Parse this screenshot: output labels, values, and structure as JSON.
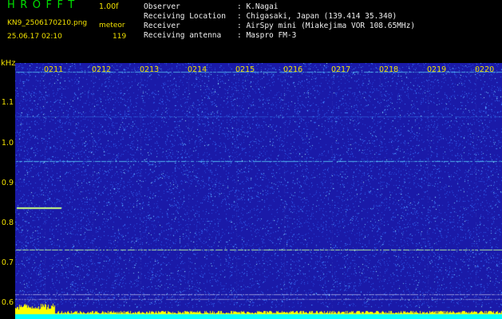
{
  "header": {
    "title": "HROFFT",
    "version": "1.00f",
    "filename": "KN9_2506170210.png",
    "mode": "meteor",
    "datetime": "25.06.17 02:10",
    "count": "119"
  },
  "info": [
    {
      "label": "Observer",
      "value": ": K.Nagai"
    },
    {
      "label": "Receiving Location",
      "value": ": Chigasaki, Japan (139.414 35.340)"
    },
    {
      "label": "Receiver",
      "value": ": AirSpy mini (Miakejima VOR 108.65MHz)"
    },
    {
      "label": "Receiving antenna",
      "value": ": Maspro FM-3"
    }
  ],
  "axis": {
    "y_unit": "kHz",
    "y_ticks": [
      "1.1",
      "1.0",
      "0.9",
      "0.8",
      "0.7",
      "0.6"
    ],
    "x_ticks": [
      "0211",
      "0212",
      "0213",
      "0214",
      "0215",
      "0216",
      "0217",
      "0218",
      "0219",
      "0220"
    ]
  },
  "colors": {
    "background": "#1a1aa8",
    "noise": "#3a6cff",
    "signal": "#c8ff80",
    "noise_floor": "#ffff00",
    "base": "#00ffff"
  }
}
